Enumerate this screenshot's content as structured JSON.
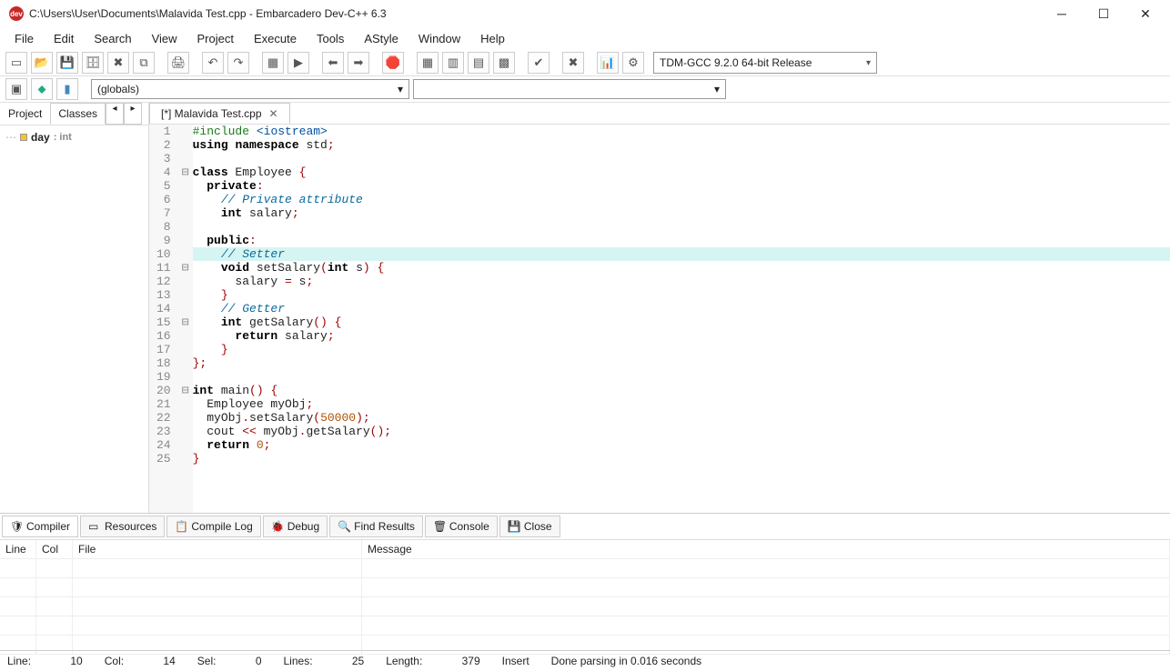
{
  "window": {
    "title": "C:\\Users\\User\\Documents\\Malavida Test.cpp - Embarcadero Dev-C++ 6.3",
    "app_icon_text": "dev"
  },
  "menu": [
    "File",
    "Edit",
    "Search",
    "View",
    "Project",
    "Execute",
    "Tools",
    "AStyle",
    "Window",
    "Help"
  ],
  "compiler_selector": "TDM-GCC 9.2.0 64-bit Release",
  "scope_selector": "(globals)",
  "sidebar": {
    "tabs": [
      "Project",
      "Classes"
    ],
    "active_tab": "Classes",
    "class_node": {
      "name": "day",
      "type": ": int"
    }
  },
  "file_tab": {
    "label": "[*] Malavida Test.cpp"
  },
  "code": {
    "highlight_line": 10,
    "lines": [
      {
        "n": 1,
        "fold": "",
        "html": "<span class='pre'>#include</span> <span class='str'>&lt;iostream&gt;</span>"
      },
      {
        "n": 2,
        "fold": "",
        "html": "<span class='kw'>using</span> <span class='kw'>namespace</span> std<span class='punc'>;</span>"
      },
      {
        "n": 3,
        "fold": "",
        "html": ""
      },
      {
        "n": 4,
        "fold": "⊟",
        "html": "<span class='kw'>class</span> Employee <span class='punc'>{</span>"
      },
      {
        "n": 5,
        "fold": "",
        "html": "  <span class='kw'>private</span><span class='punc'>:</span>"
      },
      {
        "n": 6,
        "fold": "",
        "html": "    <span class='cmt'>// Private attribute</span>"
      },
      {
        "n": 7,
        "fold": "",
        "html": "    <span class='type'>int</span> salary<span class='punc'>;</span>"
      },
      {
        "n": 8,
        "fold": "",
        "html": ""
      },
      {
        "n": 9,
        "fold": "",
        "html": "  <span class='kw'>public</span><span class='punc'>:</span>"
      },
      {
        "n": 10,
        "fold": "",
        "html": "    <span class='cmt'>// Setter</span>"
      },
      {
        "n": 11,
        "fold": "⊟",
        "html": "    <span class='type'>void</span> setSalary<span class='punc'>(</span><span class='type'>int</span> s<span class='punc'>)</span> <span class='punc'>{</span>"
      },
      {
        "n": 12,
        "fold": "",
        "html": "      salary <span class='punc'>=</span> s<span class='punc'>;</span>"
      },
      {
        "n": 13,
        "fold": "",
        "html": "    <span class='punc'>}</span>"
      },
      {
        "n": 14,
        "fold": "",
        "html": "    <span class='cmt'>// Getter</span>"
      },
      {
        "n": 15,
        "fold": "⊟",
        "html": "    <span class='type'>int</span> getSalary<span class='punc'>()</span> <span class='punc'>{</span>"
      },
      {
        "n": 16,
        "fold": "",
        "html": "      <span class='kw'>return</span> salary<span class='punc'>;</span>"
      },
      {
        "n": 17,
        "fold": "",
        "html": "    <span class='punc'>}</span>"
      },
      {
        "n": 18,
        "fold": "",
        "html": "<span class='punc'>};</span>"
      },
      {
        "n": 19,
        "fold": "",
        "html": ""
      },
      {
        "n": 20,
        "fold": "⊟",
        "html": "<span class='type'>int</span> main<span class='punc'>()</span> <span class='punc'>{</span>"
      },
      {
        "n": 21,
        "fold": "",
        "html": "  Employee myObj<span class='punc'>;</span>"
      },
      {
        "n": 22,
        "fold": "",
        "html": "  myObj<span class='punc'>.</span>setSalary<span class='punc'>(</span><span class='num'>50000</span><span class='punc'>);</span>"
      },
      {
        "n": 23,
        "fold": "",
        "html": "  cout <span class='punc'>&lt;&lt;</span> myObj<span class='punc'>.</span>getSalary<span class='punc'>();</span>"
      },
      {
        "n": 24,
        "fold": "",
        "html": "  <span class='kw'>return</span> <span class='num'>0</span><span class='punc'>;</span>"
      },
      {
        "n": 25,
        "fold": "",
        "html": "<span class='punc'>}</span>"
      }
    ]
  },
  "bottom_tabs": [
    {
      "icon": "🛡",
      "label": "Compiler"
    },
    {
      "icon": "▭",
      "label": "Resources"
    },
    {
      "icon": "📋",
      "label": "Compile Log"
    },
    {
      "icon": "🐞",
      "label": "Debug"
    },
    {
      "icon": "🔍",
      "label": "Find Results"
    },
    {
      "icon": "🗑",
      "label": "Console"
    },
    {
      "icon": "💾",
      "label": "Close"
    }
  ],
  "bottom_headers": [
    "Line",
    "Col",
    "File",
    "Message"
  ],
  "status": {
    "line": "Line:",
    "line_v": "10",
    "col": "Col:",
    "col_v": "14",
    "sel": "Sel:",
    "sel_v": "0",
    "lines": "Lines:",
    "lines_v": "25",
    "len": "Length:",
    "len_v": "379",
    "mode": "Insert",
    "msg": "Done parsing in 0.016 seconds"
  },
  "toolbar_icons": [
    "new",
    "open",
    "save",
    "save-all",
    "close",
    "close-all",
    "",
    "print",
    "",
    "undo",
    "redo",
    "",
    "compile",
    "run",
    "",
    "back",
    "fwd",
    "",
    "break",
    "",
    "grid",
    "panel",
    "panel2",
    "panel3",
    "",
    "check",
    "",
    "cancel",
    "",
    "chart",
    "gears"
  ]
}
